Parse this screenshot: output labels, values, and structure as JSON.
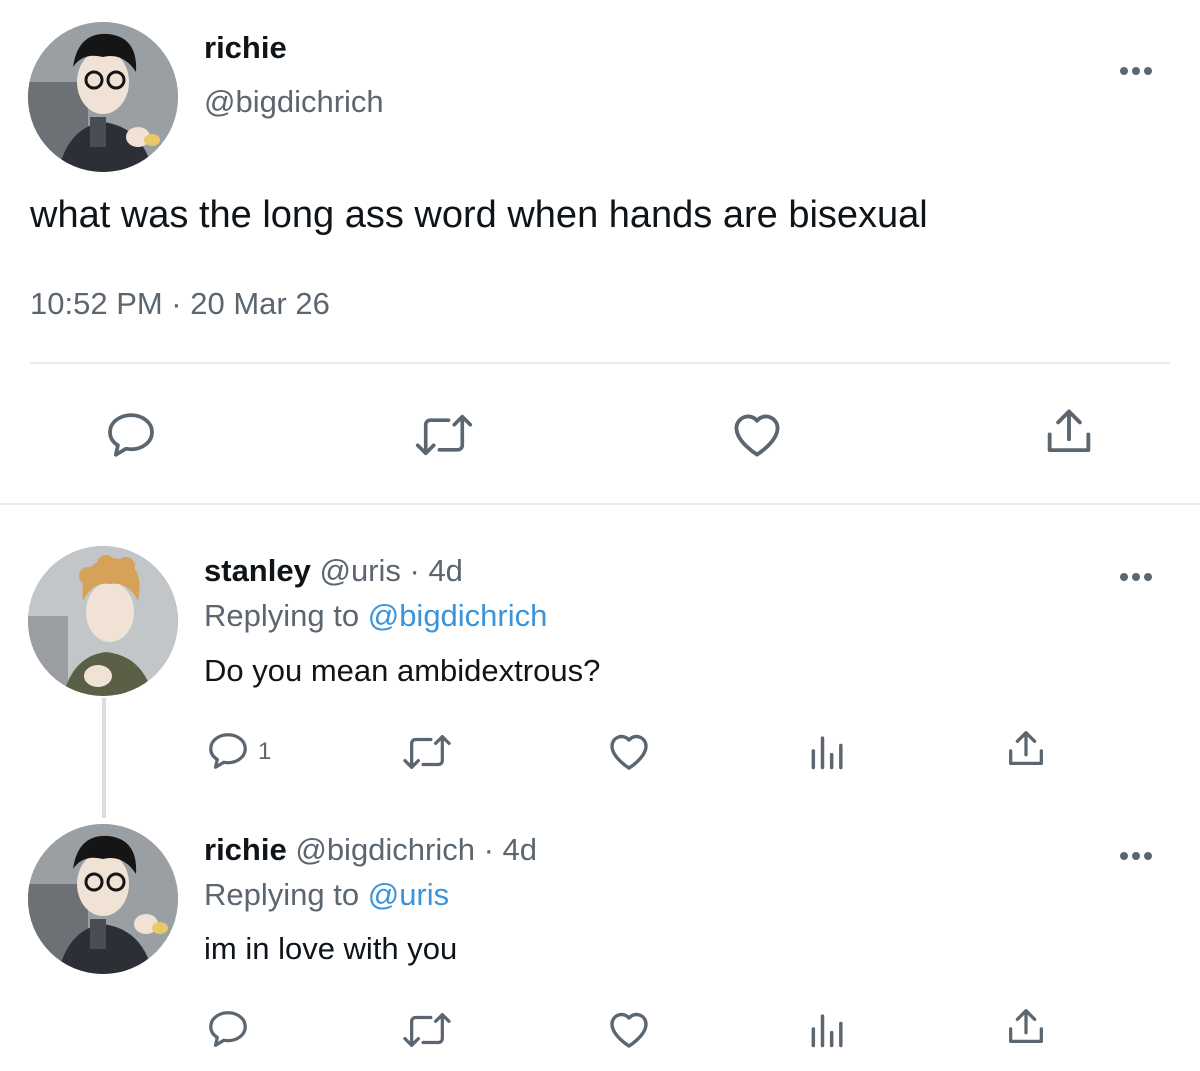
{
  "main_tweet": {
    "display_name": "richie",
    "handle": "@bigdichrich",
    "text": "what was the long ass word when hands are bisexual",
    "timestamp": "10:52 PM · 20 Mar 26",
    "actions": [
      "reply-icon",
      "retweet-icon",
      "like-icon",
      "share-icon"
    ]
  },
  "replies": [
    {
      "display_name": "stanley",
      "meta": "@uris · 4d",
      "replying_prefix": "Replying to",
      "replying_to": "@bigdichrich",
      "text": "Do you mean ambidextrous?",
      "reply_count": "1",
      "actions": [
        "reply-icon",
        "retweet-icon",
        "like-icon",
        "analytics-icon",
        "share-icon"
      ]
    },
    {
      "display_name": "richie",
      "meta": "@bigdichrich · 4d",
      "replying_prefix": "Replying to",
      "replying_to": "@uris",
      "text": "im in love with you",
      "reply_count": "",
      "actions": [
        "reply-icon",
        "retweet-icon",
        "like-icon",
        "analytics-icon",
        "share-icon"
      ]
    }
  ],
  "colors": {
    "text": "#0f1419",
    "secondary": "#5b6670",
    "link": "#3b94d9",
    "divider": "#e6ecf0"
  }
}
